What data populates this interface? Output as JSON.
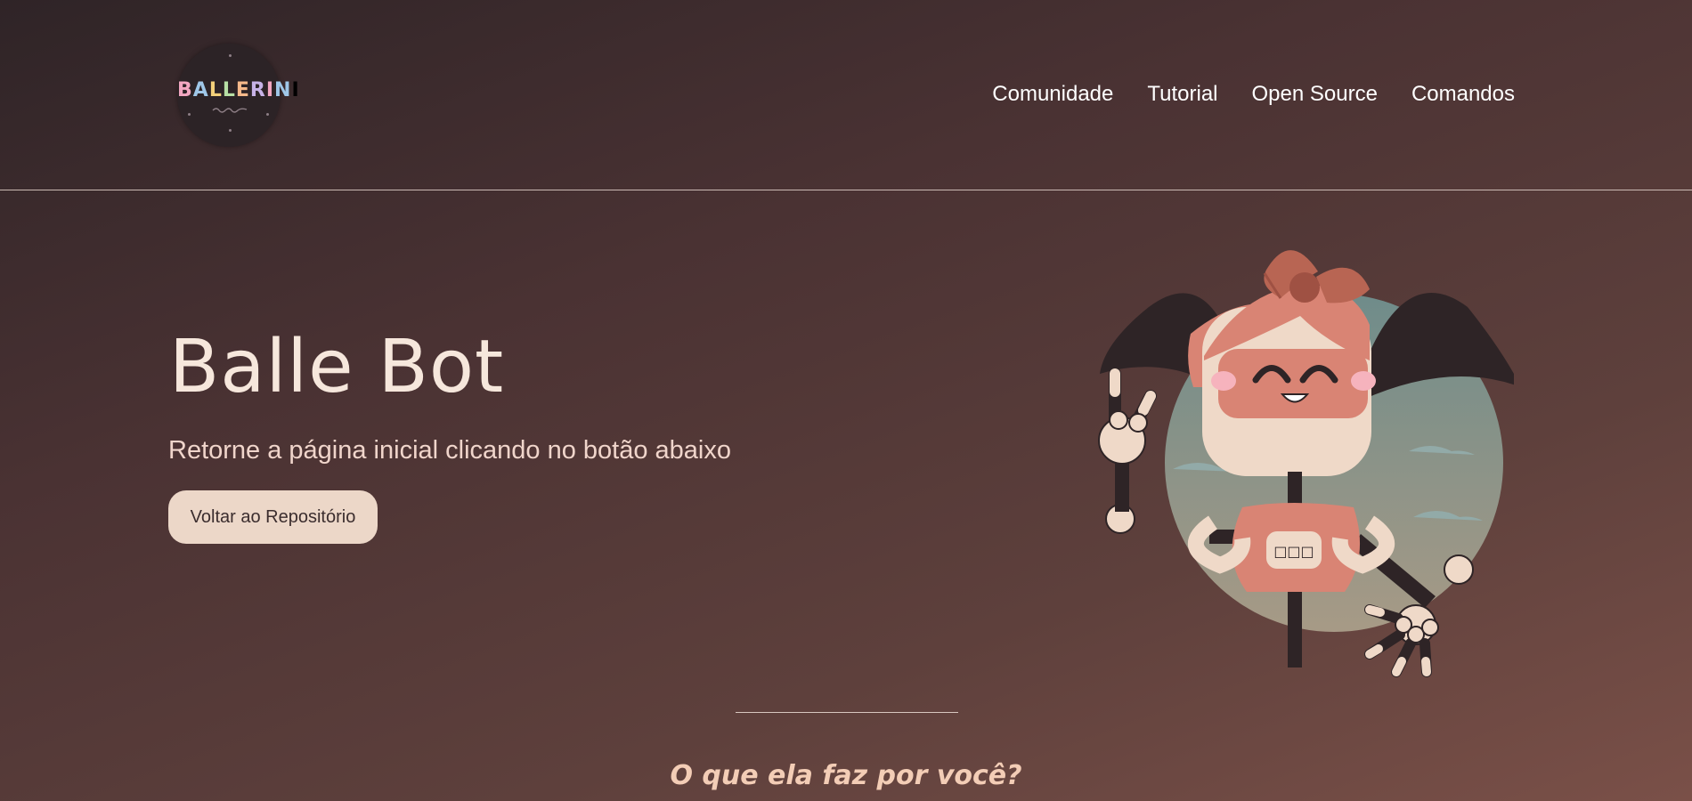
{
  "header": {
    "logo_text": [
      "B",
      "A",
      "L",
      "L",
      "E",
      "R",
      "I",
      "N",
      "I"
    ],
    "nav": [
      "Comunidade",
      "Tutorial",
      "Open Source",
      "Comandos"
    ]
  },
  "hero": {
    "title": "Balle Bot",
    "subtitle": "Retorne a página inicial clicando no botão abaixo",
    "button_label": "Voltar ao Repositório",
    "robot_chest_icons": "□□□"
  },
  "section": {
    "title": "O que ela faz por você?"
  },
  "colors": {
    "background_start": "#2f2427",
    "background_end": "#7a5048",
    "button": "#ecd7c8",
    "title": "#f6e7dc",
    "section_title": "#f3cdb6"
  }
}
